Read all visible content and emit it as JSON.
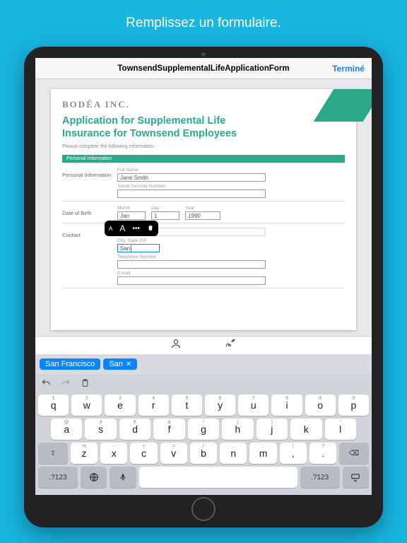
{
  "tagline": "Remplissez un formulaire.",
  "navbar": {
    "title": "TownsendSupplementalLifeApplicationForm",
    "done": "Terminé"
  },
  "doc": {
    "brand": "BODÉA INC.",
    "title_l1": "Application for Supplemental Life",
    "title_l2": "Insurance for Townsend Employees",
    "subnote": "Please complete the following information.",
    "section": "Personal Information",
    "rows": {
      "pi": "Personal Information",
      "dob": "Date of Birth",
      "contact": "Contact"
    },
    "fields": {
      "full_name_label": "Full Name",
      "full_name_value": "Jane Smith",
      "ssn_label": "Social Security Number",
      "month_label": "Month",
      "month_value": "Jan",
      "day_label": "Day",
      "day_value": "1",
      "year_label": "Year",
      "year_value": "1990",
      "city_label": "City, State ZIP",
      "city_value": "San",
      "tel_label": "Telephone Number",
      "email_label": "E-mail"
    }
  },
  "popup": {
    "smallA": "A",
    "bigA": "A",
    "dots": "•••"
  },
  "suggestions": {
    "chip1": "San Francisco",
    "chip2": "San"
  },
  "keyboard": {
    "row1_alt": [
      "1",
      "2",
      "3",
      "4",
      "5",
      "6",
      "7",
      "8",
      "9",
      "0"
    ],
    "row1": [
      "q",
      "w",
      "e",
      "r",
      "t",
      "y",
      "u",
      "i",
      "o",
      "p"
    ],
    "row2_alt": [
      "@",
      "#",
      "€",
      "&",
      "*",
      "(",
      ")",
      "'",
      "\""
    ],
    "row2": [
      "a",
      "s",
      "d",
      "f",
      "g",
      "h",
      "j",
      "k",
      "l"
    ],
    "row3_alt": [
      "%",
      "-",
      "+",
      "=",
      "/",
      ";",
      ":",
      "!",
      "?"
    ],
    "row3": [
      "z",
      "x",
      "c",
      "v",
      "b",
      "n",
      "m",
      ",",
      "."
    ],
    "mods": {
      "shift": "⇧",
      "back": "⌫",
      "numbers": ".?123",
      "globe": "🌐",
      "mic": "🎤",
      "hide": "⌨"
    }
  }
}
